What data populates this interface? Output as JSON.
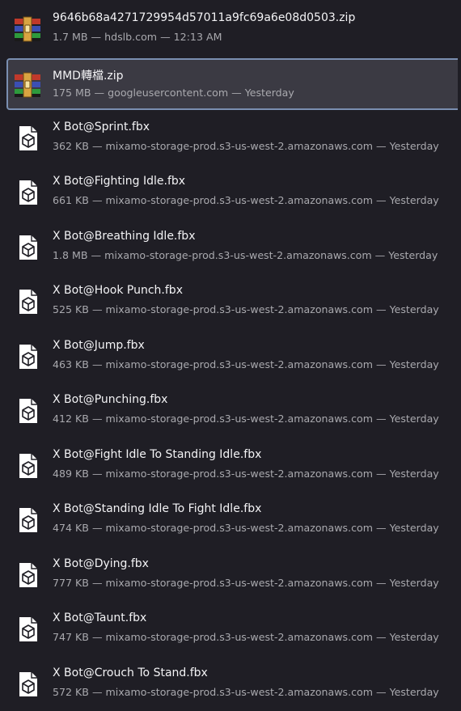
{
  "downloads": [
    {
      "filename": "9646b68a4271729954d57011a9fc69a6e08d0503.zip",
      "meta": "1.7 MB — hdslb.com — 12:13 AM",
      "icon": "winrar-archive-icon",
      "selected": false
    },
    {
      "filename": "MMD轉檔.zip",
      "meta": "175 MB — googleusercontent.com — Yesterday",
      "icon": "winrar-archive-icon",
      "selected": true
    },
    {
      "filename": "X Bot@Sprint.fbx",
      "meta": "362 KB — mixamo-storage-prod.s3-us-west-2.amazonaws.com — Yesterday",
      "icon": "3d-file-icon",
      "selected": false
    },
    {
      "filename": "X Bot@Fighting Idle.fbx",
      "meta": "661 KB — mixamo-storage-prod.s3-us-west-2.amazonaws.com — Yesterday",
      "icon": "3d-file-icon",
      "selected": false
    },
    {
      "filename": "X Bot@Breathing Idle.fbx",
      "meta": "1.8 MB — mixamo-storage-prod.s3-us-west-2.amazonaws.com — Yesterday",
      "icon": "3d-file-icon",
      "selected": false
    },
    {
      "filename": "X Bot@Hook Punch.fbx",
      "meta": "525 KB — mixamo-storage-prod.s3-us-west-2.amazonaws.com — Yesterday",
      "icon": "3d-file-icon",
      "selected": false
    },
    {
      "filename": "X Bot@Jump.fbx",
      "meta": "463 KB — mixamo-storage-prod.s3-us-west-2.amazonaws.com — Yesterday",
      "icon": "3d-file-icon",
      "selected": false
    },
    {
      "filename": "X Bot@Punching.fbx",
      "meta": "412 KB — mixamo-storage-prod.s3-us-west-2.amazonaws.com — Yesterday",
      "icon": "3d-file-icon",
      "selected": false
    },
    {
      "filename": "X Bot@Fight Idle To Standing Idle.fbx",
      "meta": "489 KB — mixamo-storage-prod.s3-us-west-2.amazonaws.com — Yesterday",
      "icon": "3d-file-icon",
      "selected": false
    },
    {
      "filename": "X Bot@Standing Idle To Fight Idle.fbx",
      "meta": "474 KB — mixamo-storage-prod.s3-us-west-2.amazonaws.com — Yesterday",
      "icon": "3d-file-icon",
      "selected": false
    },
    {
      "filename": "X Bot@Dying.fbx",
      "meta": "777 KB — mixamo-storage-prod.s3-us-west-2.amazonaws.com — Yesterday",
      "icon": "3d-file-icon",
      "selected": false
    },
    {
      "filename": "X Bot@Taunt.fbx",
      "meta": "747 KB — mixamo-storage-prod.s3-us-west-2.amazonaws.com — Yesterday",
      "icon": "3d-file-icon",
      "selected": false
    },
    {
      "filename": "X Bot@Crouch To Stand.fbx",
      "meta": "572 KB — mixamo-storage-prod.s3-us-west-2.amazonaws.com — Yesterday",
      "icon": "3d-file-icon",
      "selected": false
    }
  ]
}
